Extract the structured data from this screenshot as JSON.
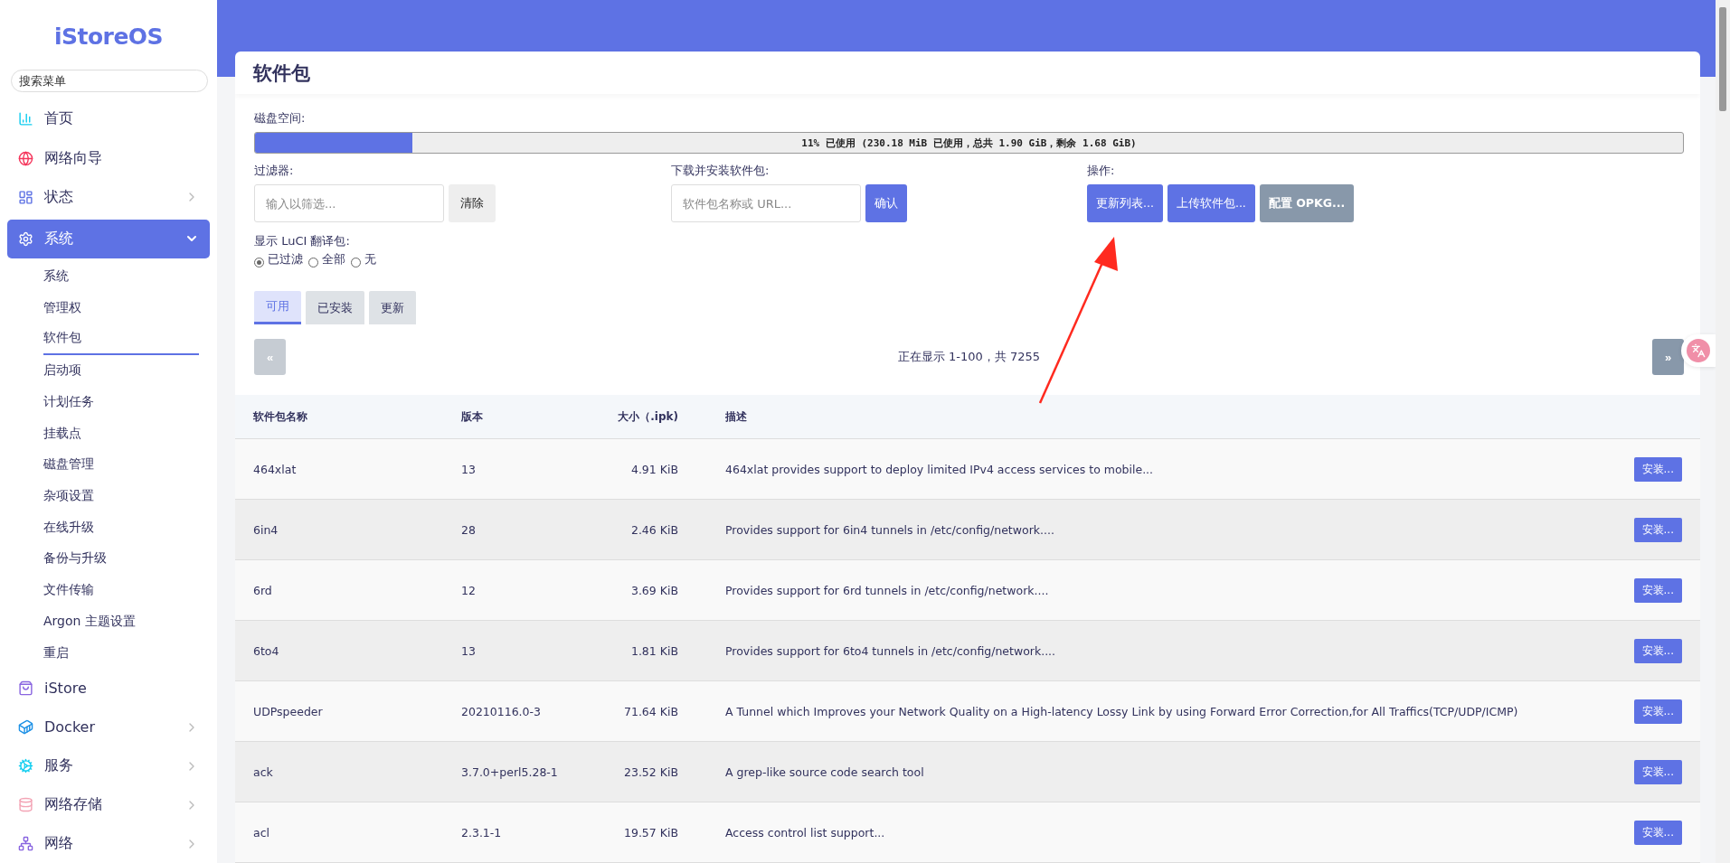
{
  "sidebar": {
    "logo": "iStoreOS",
    "search_placeholder": "搜索菜单",
    "items": [
      {
        "label": "首页",
        "selected": false
      },
      {
        "label": "网络向导",
        "selected": false
      },
      {
        "label": "状态",
        "selected": false,
        "expanded": false
      },
      {
        "label": "系统",
        "selected": true,
        "expanded": true,
        "children": [
          {
            "label": "系统",
            "selected": false
          },
          {
            "label": "管理权",
            "selected": false
          },
          {
            "label": "软件包",
            "selected": true
          },
          {
            "label": "启动项",
            "selected": false
          },
          {
            "label": "计划任务",
            "selected": false
          },
          {
            "label": "挂载点",
            "selected": false
          },
          {
            "label": "磁盘管理",
            "selected": false
          },
          {
            "label": "杂项设置",
            "selected": false
          },
          {
            "label": "在线升级",
            "selected": false
          },
          {
            "label": "备份与升级",
            "selected": false
          },
          {
            "label": "文件传输",
            "selected": false
          },
          {
            "label": "Argon 主题设置",
            "selected": false
          },
          {
            "label": "重启",
            "selected": false
          }
        ]
      },
      {
        "label": "iStore",
        "selected": false
      },
      {
        "label": "Docker",
        "selected": false,
        "expanded": false
      },
      {
        "label": "服务",
        "selected": false,
        "expanded": false
      },
      {
        "label": "网络存储",
        "selected": false,
        "expanded": false
      },
      {
        "label": "网络",
        "selected": false,
        "expanded": false
      }
    ]
  },
  "page": {
    "title": "软件包",
    "disk": {
      "label": "磁盘空间:",
      "level": 0.11,
      "reading": "11% 已使用 (230.18 MiB 已使用，总共 1.90 GiB，剩余 1.68 GiB)"
    },
    "filter": {
      "label": "过滤器:",
      "placeholder": "输入以筛选...",
      "button": "清除"
    },
    "download": {
      "label": "下载并安装软件包:",
      "placeholder": "软件包名称或 URL...",
      "button": "确认"
    },
    "actions": {
      "label": "操作:",
      "buttons": [
        {
          "label": "更新列表...",
          "kind": "primary"
        },
        {
          "label": "上传软件包...",
          "kind": "primary"
        },
        {
          "label": "配置 OPKG...",
          "kind": "secondary"
        }
      ]
    },
    "luci": {
      "label": "显示 LuCI 翻译包:",
      "options": [
        {
          "label": "已过滤",
          "selected": true
        },
        {
          "label": "全部",
          "selected": false
        },
        {
          "label": "无",
          "selected": false
        }
      ]
    },
    "tabs": [
      {
        "label": "可用",
        "selected": true
      },
      {
        "label": "已安装",
        "selected": false
      },
      {
        "label": "更新",
        "selected": false
      }
    ],
    "pager": {
      "prev": {
        "label": "«",
        "disabled": true
      },
      "status": "正在显示 1-100，共 7255",
      "next": {
        "label": "»",
        "disabled": false
      }
    },
    "table": {
      "columns": [
        "软件包名称",
        "版本",
        "大小（.ipk)",
        "描述"
      ],
      "rows": [
        {
          "name": "464xlat",
          "version": "13",
          "size": "4.91 KiB",
          "description": "464xlat provides support to deploy limited IPv4 access services to mobile...",
          "action": "安装..."
        },
        {
          "name": "6in4",
          "version": "28",
          "size": "2.46 KiB",
          "description": "Provides support for 6in4 tunnels in /etc/config/network....",
          "action": "安装..."
        },
        {
          "name": "6rd",
          "version": "12",
          "size": "3.69 KiB",
          "description": "Provides support for 6rd tunnels in /etc/config/network....",
          "action": "安装..."
        },
        {
          "name": "6to4",
          "version": "13",
          "size": "1.81 KiB",
          "description": "Provides support for 6to4 tunnels in /etc/config/network....",
          "action": "安装..."
        },
        {
          "name": "UDPspeeder",
          "version": "20210116.0-3",
          "size": "71.64 KiB",
          "description": "A Tunnel which Improves your Network Quality on a High-latency Lossy Link by using Forward Error Correction,for All Traffics(TCP/UDP/ICMP)",
          "action": "安装..."
        },
        {
          "name": "ack",
          "version": "3.7.0+perl5.28-1",
          "size": "23.52 KiB",
          "description": "A grep-like source code search tool",
          "action": "安装..."
        },
        {
          "name": "acl",
          "version": "2.3.1-1",
          "size": "19.57 KiB",
          "description": "Access control list support...",
          "action": "安装..."
        }
      ]
    }
  }
}
